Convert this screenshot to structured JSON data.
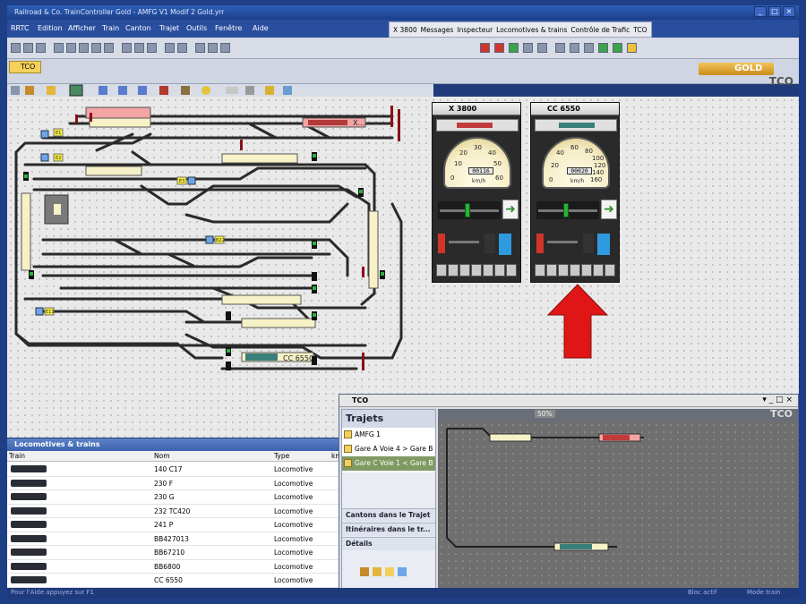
{
  "window": {
    "title": "Railroad & Co. TrainController Gold - AMFG V1 Modif 2 Gold.yrr"
  },
  "menu": [
    "RRTC",
    "Edition",
    "Afficher",
    "Train",
    "Canton",
    "Trajet",
    "Outils",
    "Fenêtre",
    "Aide"
  ],
  "top_toolbar": [
    "X 3800",
    "Messages",
    "Inspecteur",
    "Locomotives & trains",
    "Contrôle de Trafic",
    "TCO"
  ],
  "tab": {
    "label": "TCO"
  },
  "brand": {
    "logo_text": "GOLD",
    "view_label": "TCO"
  },
  "layout_labels": {
    "train_x": "X...",
    "train_cc": "CC 6550",
    "block_ids": [
      "E1",
      "E2",
      "E3",
      "B22",
      "E11"
    ]
  },
  "throttles": [
    {
      "name": "X 3800",
      "scale": [
        "10",
        "20",
        "30",
        "40",
        "50",
        "60",
        "0"
      ],
      "odometer": "00116",
      "unit": "km/h"
    },
    {
      "name": "CC 6550",
      "scale": [
        "20",
        "40",
        "60",
        "80",
        "100",
        "120",
        "140",
        "160",
        "0"
      ],
      "odometer": "00020",
      "unit": "km/h"
    }
  ],
  "locomotives_panel": {
    "title": "Locomotives & trains",
    "columns": [
      "Train",
      "Nom",
      "Type",
      "km"
    ],
    "rows": [
      {
        "name": "140 C17",
        "type": "Locomotive"
      },
      {
        "name": "230 F",
        "type": "Locomotive"
      },
      {
        "name": "230 G",
        "type": "Locomotive"
      },
      {
        "name": "232 TC420",
        "type": "Locomotive"
      },
      {
        "name": "241 P",
        "type": "Locomotive"
      },
      {
        "name": "BB427013",
        "type": "Locomotive"
      },
      {
        "name": "BB67210",
        "type": "Locomotive"
      },
      {
        "name": "BB6800",
        "type": "Locomotive"
      },
      {
        "name": "CC 6550",
        "type": "Locomotive"
      }
    ]
  },
  "tco_window": {
    "title": "TCO",
    "label": "TCO",
    "trajets_header": "Trajets",
    "trajets": [
      "AMFG 1",
      "Gare A Voie 4 > Gare B ...",
      "Gare C Voie 1 < Gare B ..."
    ],
    "selected_index": 2,
    "sections": [
      "Cantons dans le Trajet",
      "Itinéraires dans le tr...",
      "Détails"
    ],
    "zoom": "50%"
  },
  "status": {
    "help": "Pour l'Aide appuyez sur F1",
    "mode": "Bloc actif",
    "extra": "Mode train"
  },
  "colors": {
    "accent": "#2a4e9e",
    "track": "#2a2a2a",
    "red_signal": "#8b0f1a",
    "pale_block": "#f7f1c7",
    "selected_block": "#f3a4a4",
    "arrow": "#e01616"
  }
}
